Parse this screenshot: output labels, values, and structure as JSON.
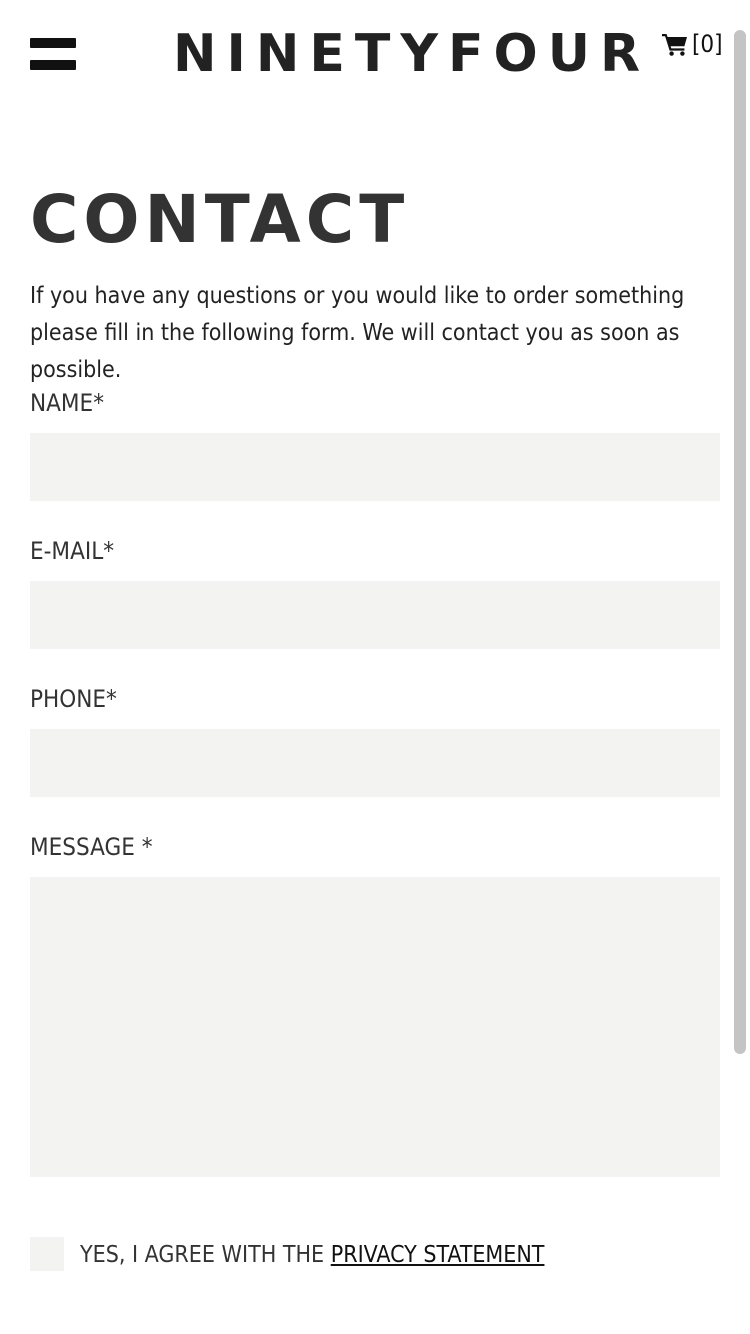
{
  "header": {
    "logo_text": "NINETYFOUR",
    "cart_count": "[0]",
    "menu_icon": "hamburger-icon",
    "cart_icon": "shopping-cart-icon"
  },
  "page": {
    "title": "CONTACT",
    "intro": "If you have any questions or you would like to order something please fill in the following form. We will contact you as soon as possible."
  },
  "form": {
    "name_label": "NAME*",
    "name_value": "",
    "email_label": "E-MAIL*",
    "email_value": "",
    "phone_label": "PHONE*",
    "phone_value": "",
    "message_label": "MESSAGE *",
    "message_value": "",
    "consent_text": "YES, I AGREE WITH THE",
    "consent_link": "PRIVACY STATEMENT",
    "consent_checked": false
  },
  "colors": {
    "text": "#333333",
    "logo": "#222222",
    "input_background": "#f3f3f2",
    "scrollbar": "#c4c4c4"
  }
}
